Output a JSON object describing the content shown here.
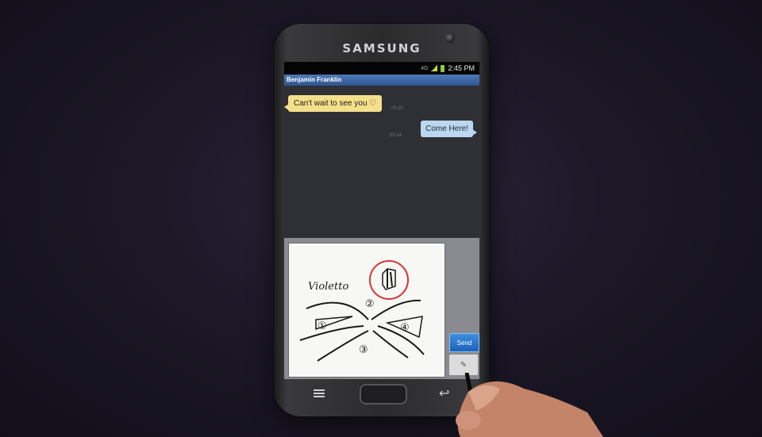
{
  "device": {
    "brand": "SAMSUNG"
  },
  "statusbar": {
    "network": "4G",
    "time": "2:45 PM"
  },
  "conversation": {
    "contact_name": "Benjamin Franklin",
    "messages": [
      {
        "direction": "incoming",
        "text": "Can't wait to see you ♡",
        "time": "05:20"
      },
      {
        "direction": "outgoing",
        "text": "Come Here!",
        "time": "05:24"
      }
    ]
  },
  "drawing": {
    "label": "Violetto",
    "markers": [
      "①",
      "②",
      "③",
      "④"
    ],
    "stroke_color": "#1a1a1a",
    "circle_color": "#d93434"
  },
  "compose": {
    "send_label": "Send",
    "attach_icon": "paperclip-icon"
  },
  "colors": {
    "titlebar": "#3b66a6",
    "incoming_bubble": "#f4e08a",
    "outgoing_bubble": "#bcd7ef",
    "send_button": "#2a78d0"
  }
}
